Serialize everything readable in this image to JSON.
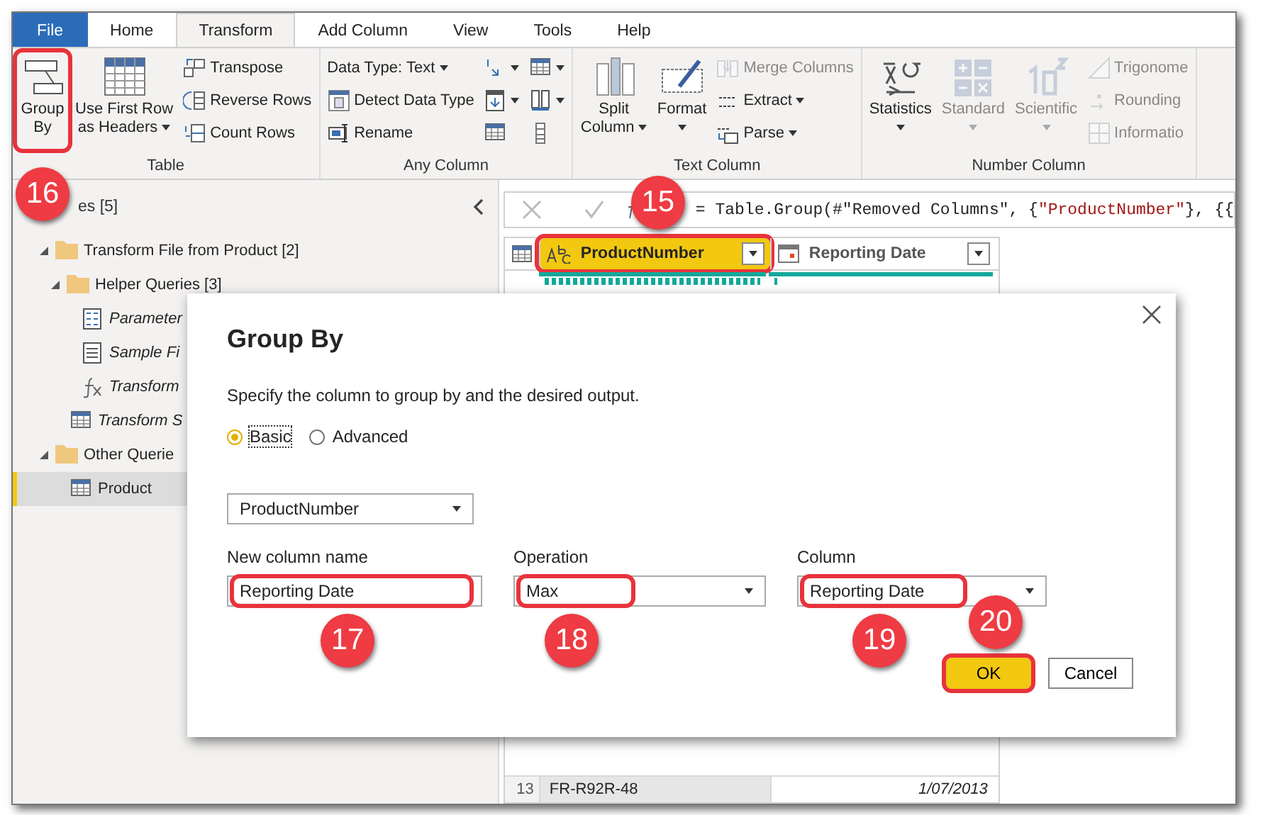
{
  "tabs": [
    {
      "kind": "file",
      "label": "File",
      "selected": false
    },
    {
      "kind": "tab",
      "label": "Home",
      "selected": false
    },
    {
      "kind": "tab",
      "label": "Transform",
      "selected": true
    },
    {
      "kind": "tab",
      "label": "Add Column",
      "selected": false
    },
    {
      "kind": "tab",
      "label": "View",
      "selected": false
    },
    {
      "kind": "tab",
      "label": "Tools",
      "selected": false
    },
    {
      "kind": "tab",
      "label": "Help",
      "selected": false
    }
  ],
  "ribbon": {
    "groups": [
      {
        "label": "Table",
        "columns": [
          [
            {
              "kind": "large",
              "lines": [
                "Group",
                "By"
              ],
              "dropdown": false,
              "disabled": false,
              "callout": "16"
            }
          ],
          [
            {
              "kind": "large",
              "lines": [
                "Use First Row",
                "as Headers"
              ],
              "dropdown": true,
              "disabled": false
            }
          ],
          [
            {
              "kind": "small",
              "label": "Transpose",
              "dropdown": false,
              "disabled": false
            },
            {
              "kind": "small",
              "label": "Reverse Rows",
              "dropdown": false,
              "disabled": false
            },
            {
              "kind": "small",
              "label": "Count Rows",
              "dropdown": false,
              "disabled": false
            }
          ]
        ]
      },
      {
        "label": "Any Column",
        "columns": [
          [
            {
              "kind": "text",
              "label": "Data Type: Text",
              "dropdown": true,
              "disabled": false
            },
            {
              "kind": "small",
              "label": "Detect Data Type",
              "dropdown": false,
              "disabled": false
            },
            {
              "kind": "small",
              "label": "Rename",
              "dropdown": false,
              "disabled": false
            }
          ],
          [
            {
              "kind": "icon",
              "dropdown": true,
              "disabled": false
            },
            {
              "kind": "icon",
              "dropdown": true,
              "disabled": false
            },
            {
              "kind": "icon",
              "dropdown": false,
              "disabled": false
            }
          ],
          [
            {
              "kind": "icon",
              "dropdown": true,
              "disabled": false
            },
            {
              "kind": "icon",
              "dropdown": true,
              "disabled": false
            },
            {
              "kind": "icon",
              "dropdown": false,
              "disabled": false
            }
          ]
        ]
      },
      {
        "label": "Text Column",
        "columns": [
          [
            {
              "kind": "large",
              "lines": [
                "Split",
                "Column"
              ],
              "dropdown": true,
              "disabled": false
            }
          ],
          [
            {
              "kind": "large",
              "lines": [
                "Format"
              ],
              "dropdown": true,
              "disabled": false
            }
          ],
          [
            {
              "kind": "small",
              "label": "Merge Columns",
              "dropdown": false,
              "disabled": true
            },
            {
              "kind": "small",
              "label": "Extract",
              "dropdown": true,
              "disabled": false
            },
            {
              "kind": "small",
              "label": "Parse",
              "dropdown": true,
              "disabled": false
            }
          ]
        ]
      },
      {
        "label": "Number Column",
        "columns": [
          [
            {
              "kind": "large",
              "lines": [
                "Statistics"
              ],
              "dropdown": true,
              "disabled": false
            }
          ],
          [
            {
              "kind": "large",
              "lines": [
                "Standard"
              ],
              "dropdown": true,
              "disabled": true
            }
          ],
          [
            {
              "kind": "large",
              "lines": [
                "Scientific"
              ],
              "dropdown": true,
              "disabled": true
            }
          ],
          [
            {
              "kind": "small",
              "label": "Trigonome",
              "dropdown": false,
              "disabled": true
            },
            {
              "kind": "small",
              "label": "Rounding",
              "dropdown": false,
              "disabled": true
            },
            {
              "kind": "small",
              "label": "Informatio",
              "dropdown": false,
              "disabled": true
            }
          ]
        ]
      }
    ]
  },
  "queries": {
    "title": "es [5]",
    "items": [
      {
        "kind": "folder",
        "label": "Transform File from Product [2]",
        "expanded": true,
        "selected": false,
        "children": [
          {
            "kind": "folder",
            "label": "Helper Queries [3]",
            "expanded": true,
            "selected": false,
            "children": [
              {
                "kind": "parameter",
                "label": "Parameter",
                "load_enabled": false,
                "selected": false
              },
              {
                "kind": "file",
                "label": "Sample Fi",
                "load_enabled": false,
                "selected": false
              },
              {
                "kind": "function",
                "label": "Transform",
                "load_enabled": false,
                "selected": false
              }
            ]
          },
          {
            "kind": "table",
            "label": "Transform S",
            "load_enabled": false,
            "selected": false
          }
        ]
      },
      {
        "kind": "folder",
        "label": "Other Querie",
        "expanded": true,
        "selected": false,
        "children": [
          {
            "kind": "table",
            "label": "Product",
            "load_enabled": true,
            "selected": true
          }
        ]
      }
    ]
  },
  "formula": {
    "tokens": [
      {
        "kind": "plain",
        "text": "= Table.Group(#\"Removed Columns\", {"
      },
      {
        "kind": "string",
        "text": "\"ProductNumber\""
      },
      {
        "kind": "plain",
        "text": "}, {{"
      }
    ]
  },
  "table": {
    "columns": [
      {
        "kind": "text",
        "name": "ProductNumber",
        "selected": true,
        "callout": "15"
      },
      {
        "kind": "date",
        "name": "Reporting Date",
        "selected": false
      }
    ],
    "rows": [
      {
        "number": "13",
        "cells": [
          "FR-R92R-48",
          "1/07/2013"
        ]
      }
    ]
  },
  "dialog": {
    "title": "Group By",
    "description": "Specify the column to group by and the desired output.",
    "modes": [
      {
        "label": "Basic",
        "selected": true
      },
      {
        "label": "Advanced",
        "selected": false
      }
    ],
    "group_column": "ProductNumber",
    "fields": [
      {
        "kind": "text",
        "label": "New column name",
        "value": "Reporting Date",
        "callout": "17"
      },
      {
        "kind": "dropdown",
        "label": "Operation",
        "value": "Max",
        "callout": "18"
      },
      {
        "kind": "dropdown",
        "label": "Column",
        "value": "Reporting Date",
        "callout": "19"
      }
    ],
    "buttons": [
      {
        "kind": "primary",
        "label": "OK",
        "callout": "20"
      },
      {
        "kind": "secondary",
        "label": "Cancel"
      }
    ]
  }
}
